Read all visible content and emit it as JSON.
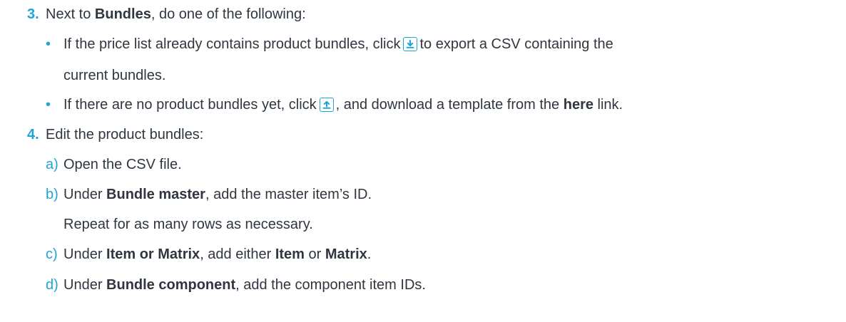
{
  "step3": {
    "number": "3.",
    "pre": "Next to ",
    "bold": "Bundles",
    "post": ", do one of the following:"
  },
  "bullets": [
    {
      "line1_pre": "If the price list already contains product bundles, click",
      "icon": "download-icon",
      "line1_post": "to export a CSV containing the",
      "line2": "current bundles."
    },
    {
      "pre": "If there are no product bundles yet, click",
      "icon": "upload-icon",
      "mid": ", and download a template from the ",
      "bold": "here",
      "post": " link."
    }
  ],
  "step4": {
    "number": "4.",
    "text": "Edit the product bundles:"
  },
  "substeps": {
    "a": {
      "letter": "a)",
      "text": "Open the CSV file."
    },
    "b": {
      "letter": "b)",
      "pre": "Under ",
      "bold": "Bundle master",
      "post": ", add the master item’s ID.",
      "note": "Repeat for as many rows as necessary."
    },
    "c": {
      "letter": "c)",
      "pre": "Under ",
      "bold": "Item or Matrix",
      "mid1": ", add either ",
      "bold2": "Item",
      "mid2": " or ",
      "bold3": "Matrix",
      "post": "."
    },
    "d": {
      "letter": "d)",
      "pre": "Under ",
      "bold": "Bundle component",
      "post": ", add the component item IDs."
    }
  },
  "colors": {
    "accent": "#1ea5d6",
    "text": "#2f3640"
  }
}
